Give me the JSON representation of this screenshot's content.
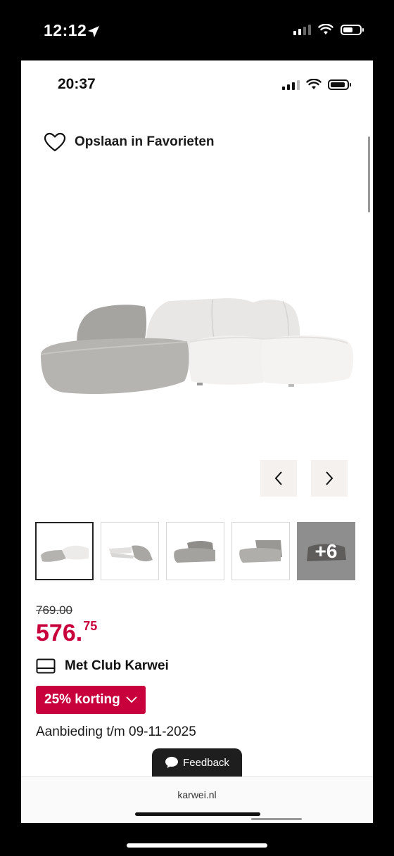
{
  "device_status": {
    "time": "12:12",
    "icons": [
      "location-arrow-icon",
      "signal-icon",
      "wifi-icon",
      "battery-icon"
    ]
  },
  "inner_status": {
    "time": "20:37",
    "icons": [
      "signal-icon",
      "wifi-icon",
      "battery-icon"
    ]
  },
  "product": {
    "favorite_label": "Opslaan in Favorieten",
    "gallery": {
      "more_count_label": "+6",
      "thumbnails": [
        "sofa-corner-view",
        "sofa-top-view",
        "sofa-module-1",
        "sofa-module-2",
        "sofa-more"
      ]
    },
    "old_price": "769.00",
    "price_main": "576.",
    "price_cents": "75",
    "club_label": "Met Club Karwei",
    "discount_label": "25% korting",
    "offer_text": "Aanbieding t/m 09-11-2025"
  },
  "feedback_label": "Feedback",
  "browser": {
    "url": "karwei.nl"
  },
  "colors": {
    "accent": "#c8003c",
    "nav_bg": "#f4f1ee",
    "thumb_more_bg": "#8e8e8e"
  }
}
